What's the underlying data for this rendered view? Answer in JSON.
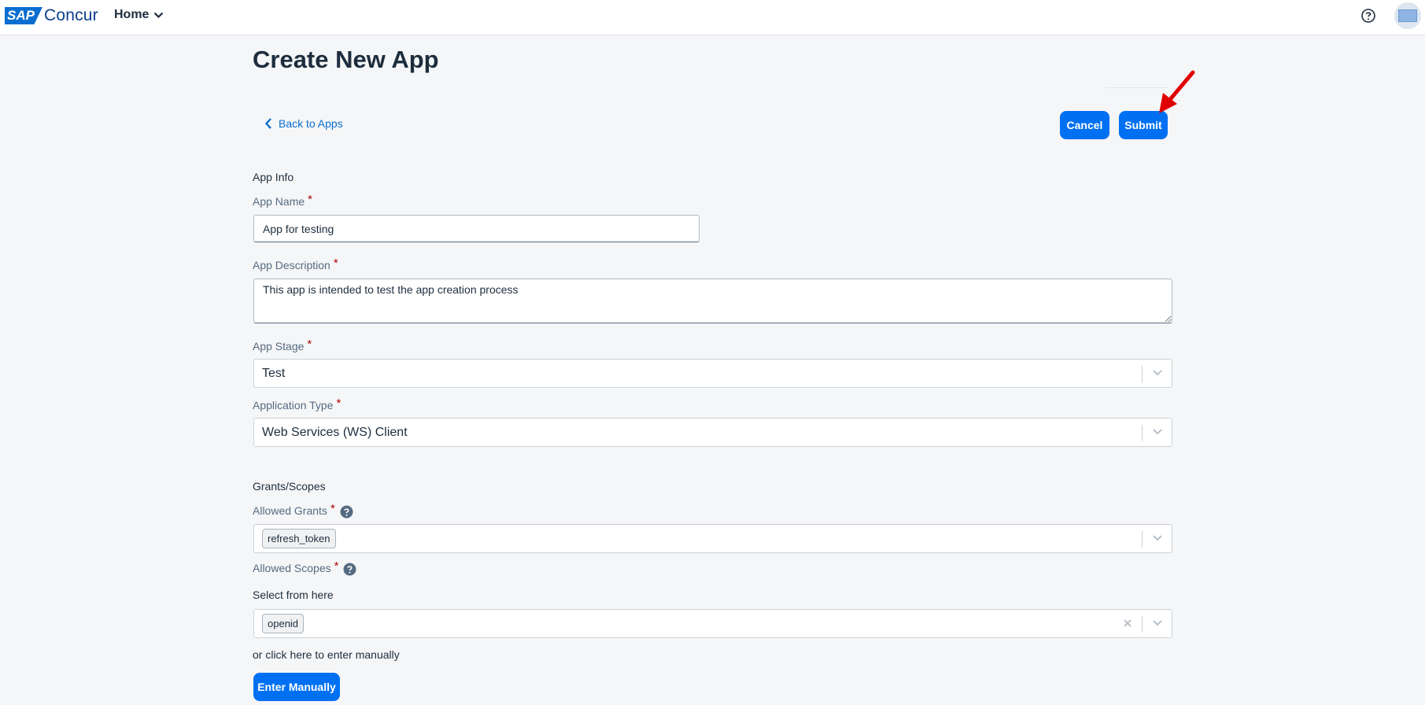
{
  "header": {
    "logo_badge": "SAP",
    "logo_text": "Concur",
    "home_label": "Home"
  },
  "page": {
    "title": "Create New App",
    "back_label": "Back to Apps"
  },
  "actions": {
    "cancel_label": "Cancel",
    "submit_label": "Submit",
    "accent_color": "#0070f2"
  },
  "app_info": {
    "section_title": "App Info",
    "required_marker": "*",
    "app_name": {
      "label": "App Name",
      "value": "App for testing"
    },
    "app_description": {
      "label": "App Description",
      "value": "This app is intended to test the app creation process"
    },
    "app_stage": {
      "label": "App Stage",
      "value": "Test"
    },
    "application_type": {
      "label": "Application Type",
      "value": "Web Services (WS) Client"
    }
  },
  "grants_scopes": {
    "section_title": "Grants/Scopes",
    "allowed_grants": {
      "label": "Allowed Grants",
      "chips": [
        "refresh_token"
      ]
    },
    "allowed_scopes": {
      "label": "Allowed Scopes",
      "chips": [
        "openid"
      ]
    },
    "select_hint": "Select from here",
    "manual_hint": "or click here to enter manually",
    "enter_manually_label": "Enter Manually"
  },
  "icons": {
    "help": "help-circle-icon",
    "info": "info-circle-icon",
    "back": "chevron-left-icon",
    "dropdown": "chevron-down-icon",
    "clear": "close-icon",
    "annotation": "red-arrow-icon"
  },
  "colors": {
    "required": "#aa0808",
    "link": "#0a6ed1",
    "annotation": "#e00000"
  }
}
